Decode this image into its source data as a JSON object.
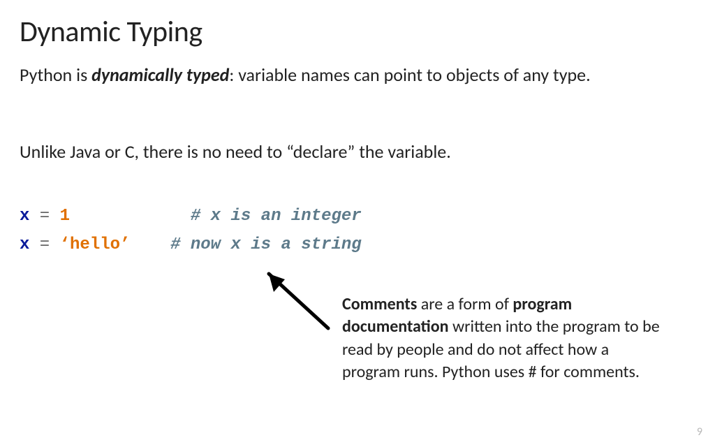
{
  "title": "Dynamic Typing",
  "para1": {
    "pre": "Python is ",
    "emph": "dynamically typed",
    "post": ": variable names can point to objects of any type."
  },
  "para2": "Unlike Java or C, there is no need to “declare” the variable.",
  "code": {
    "line1": {
      "var": "x",
      "op": " = ",
      "val": "1",
      "pad": "            ",
      "comment": "# x is an integer"
    },
    "line2": {
      "var": "x",
      "op": " = ",
      "val": "‘hello’",
      "pad": "    ",
      "comment": "# now x is a string"
    }
  },
  "annotation": {
    "b1": "Comments",
    "t1": " are a form of ",
    "b2": "program documentation",
    "t2": " written into the program to be read by people and do not affect how a program runs. Python uses # for comments."
  },
  "page_number": "9"
}
